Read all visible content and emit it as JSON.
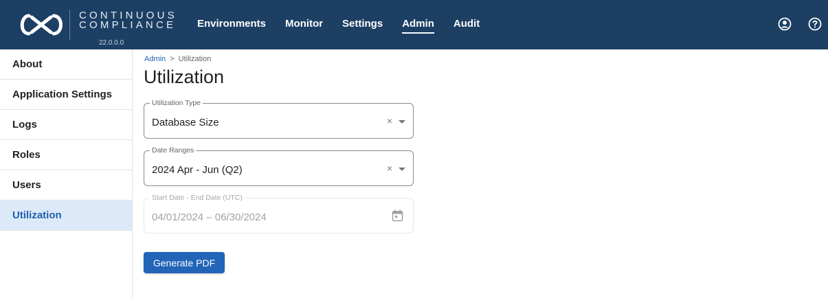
{
  "app": {
    "logo_text_line1": "CONTINUOUS",
    "logo_text_line2": "COMPLIANCE",
    "version": "22.0.0.0"
  },
  "nav": {
    "items": [
      {
        "label": "Environments",
        "active": false
      },
      {
        "label": "Monitor",
        "active": false
      },
      {
        "label": "Settings",
        "active": false
      },
      {
        "label": "Admin",
        "active": true
      },
      {
        "label": "Audit",
        "active": false
      }
    ]
  },
  "top_icons": [
    "account-circle-icon",
    "help-circle-icon"
  ],
  "sidebar": {
    "items": [
      {
        "label": "About",
        "active": false
      },
      {
        "label": "Application Settings",
        "active": false
      },
      {
        "label": "Logs",
        "active": false
      },
      {
        "label": "Roles",
        "active": false
      },
      {
        "label": "Users",
        "active": false
      },
      {
        "label": "Utilization",
        "active": true
      }
    ]
  },
  "breadcrumb": {
    "parent": "Admin",
    "separator": ">",
    "current": "Utilization"
  },
  "page": {
    "title": "Utilization"
  },
  "form": {
    "utilization_type": {
      "label": "Utilization Type",
      "value": "Database Size",
      "clear": "×"
    },
    "date_ranges": {
      "label": "Date Ranges",
      "value": "2024 Apr - Jun (Q2)",
      "clear": "×"
    },
    "date_range_picker": {
      "label": "Start Date - End Date (UTC)",
      "value": "04/01/2024 – 06/30/2024",
      "disabled": true
    },
    "generate_label": "Generate PDF"
  },
  "colors": {
    "header_bg": "#1c3f63",
    "accent": "#2164b8",
    "sidebar_active_bg": "#dce9f8",
    "sidebar_active_text": "#1f5fae"
  }
}
